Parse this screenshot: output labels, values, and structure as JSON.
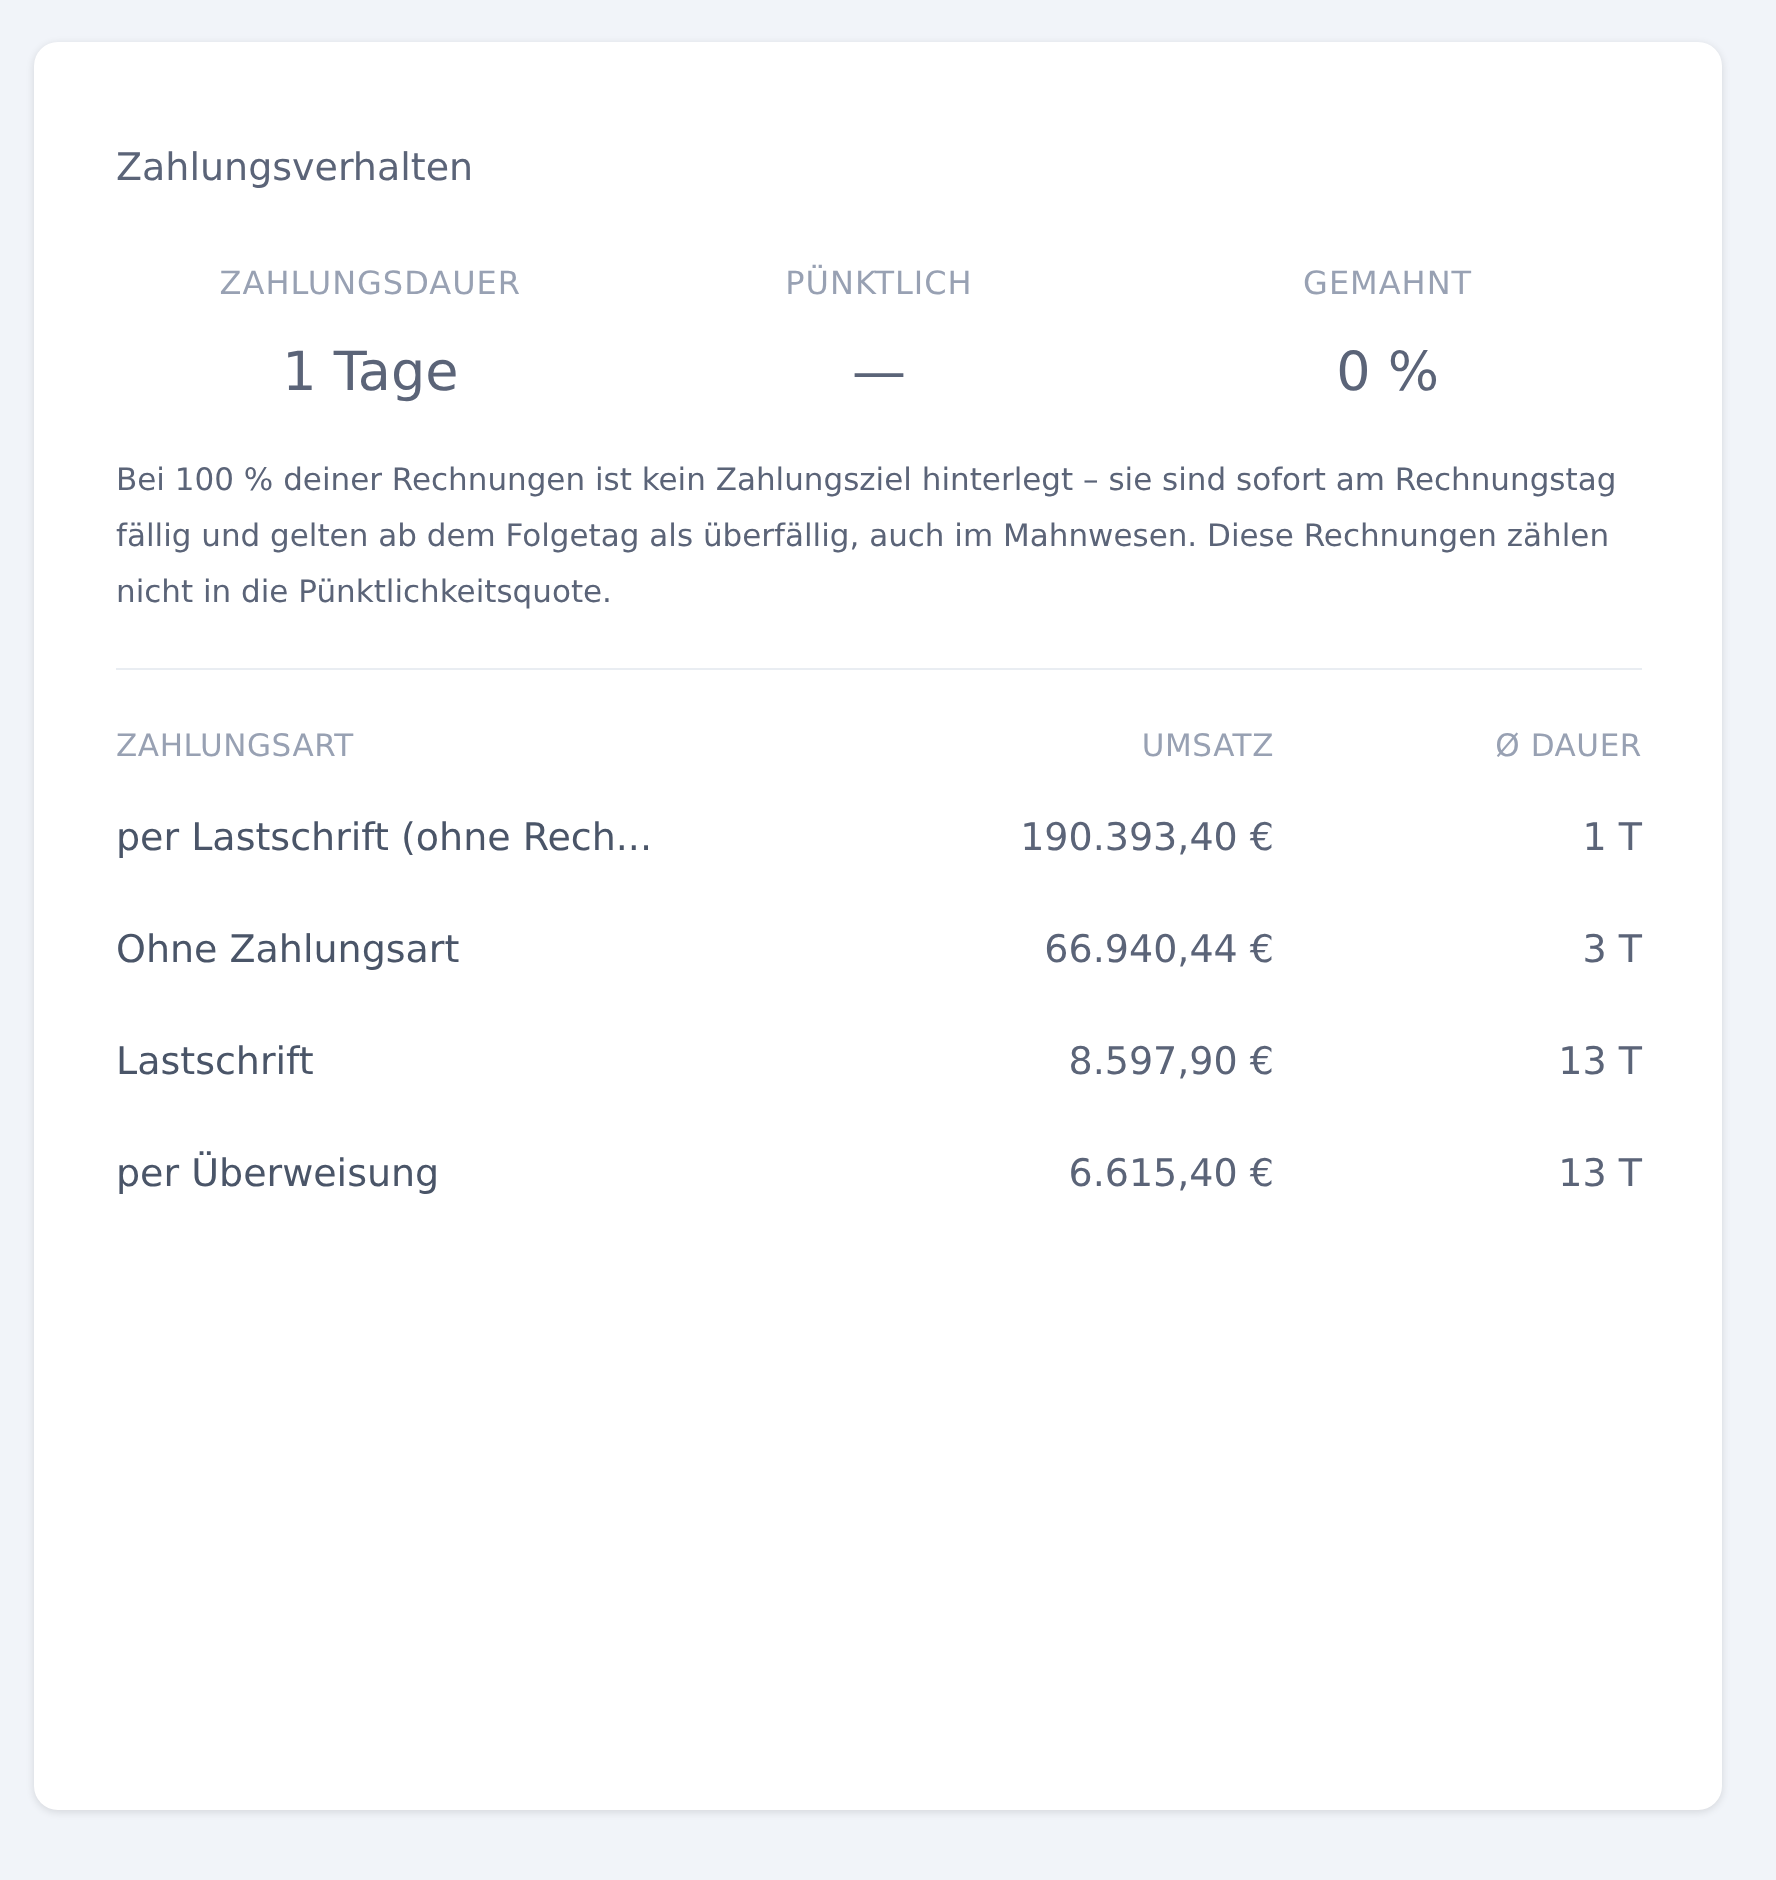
{
  "card": {
    "title": "Zahlungsverhalten",
    "stats": [
      {
        "label": "ZAHLUNGSDAUER",
        "value": "1 Tage"
      },
      {
        "label": "PÜNKTLICH",
        "value": "—"
      },
      {
        "label": "GEMAHNT",
        "value": "0 %"
      }
    ],
    "note": "Bei 100 % deiner Rechnungen ist kein Zahlungsziel hinterlegt – sie sind sofort am Rechnungstag fällig und gelten ab dem Folgetag als überfällig, auch im Mahnwesen. Diese Rechnungen zählen nicht in die Pünktlichkeitsquote.",
    "table": {
      "columns": [
        "ZAHLUNGSART",
        "UMSATZ",
        "Ø DAUER"
      ],
      "rows": [
        [
          "per Lastschrift (ohne Rech...",
          "190.393,40 €",
          "1 T"
        ],
        [
          "Ohne Zahlungsart",
          "66.940,44 €",
          "3 T"
        ],
        [
          "Lastschrift",
          "8.597,90 €",
          "13 T"
        ],
        [
          "per Überweisung",
          "6.615,40 €",
          "13 T"
        ]
      ]
    }
  }
}
